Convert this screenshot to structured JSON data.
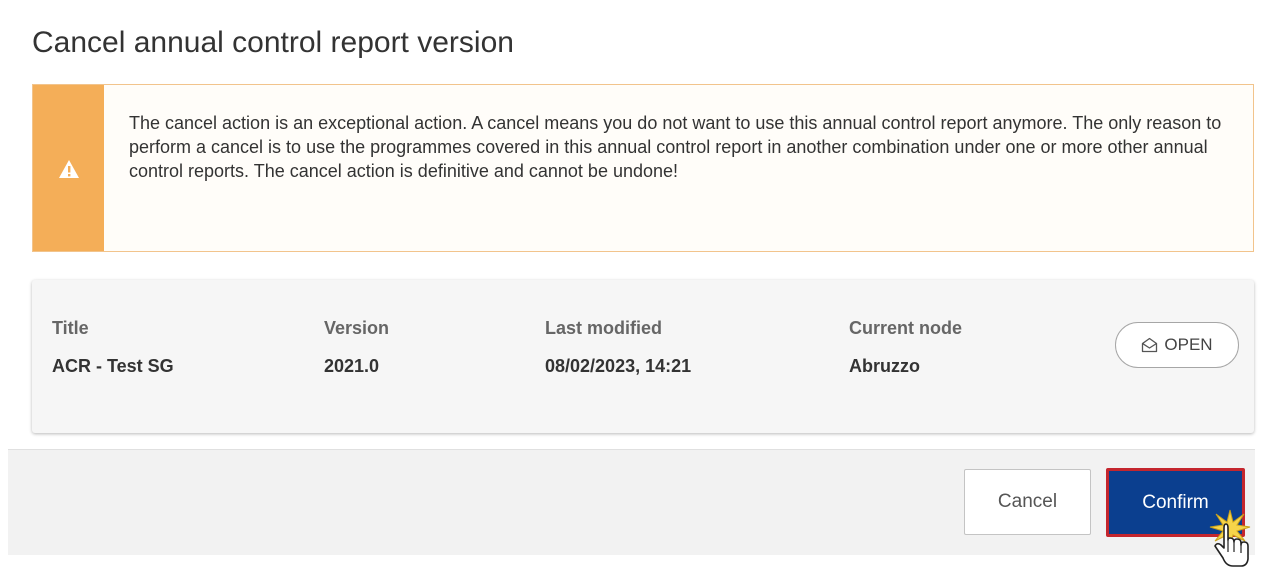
{
  "dialog": {
    "title": "Cancel annual control report version"
  },
  "alert": {
    "icon": "warning-icon",
    "accent_color": "#f4ae58",
    "message": "The cancel action is an exceptional action. A cancel means you do not want to use this annual control report anymore. The only reason to perform a cancel is to use the programmes covered in this annual control report in another combination under one or more other annual control reports. The cancel action is definitive and cannot be undone!"
  },
  "report": {
    "columns": [
      {
        "label": "Title",
        "value": "ACR - Test SG"
      },
      {
        "label": "Version",
        "value": "2021.0"
      },
      {
        "label": "Last modified",
        "value": "08/02/2023, 14:21"
      },
      {
        "label": "Current node",
        "value": "Abruzzo"
      }
    ],
    "open_button": {
      "label": "OPEN",
      "icon": "open-envelope-icon"
    }
  },
  "footer": {
    "cancel_label": "Cancel",
    "confirm_label": "Confirm",
    "confirm_color": "#0b3f8f",
    "confirm_border_color": "#c4262e"
  }
}
